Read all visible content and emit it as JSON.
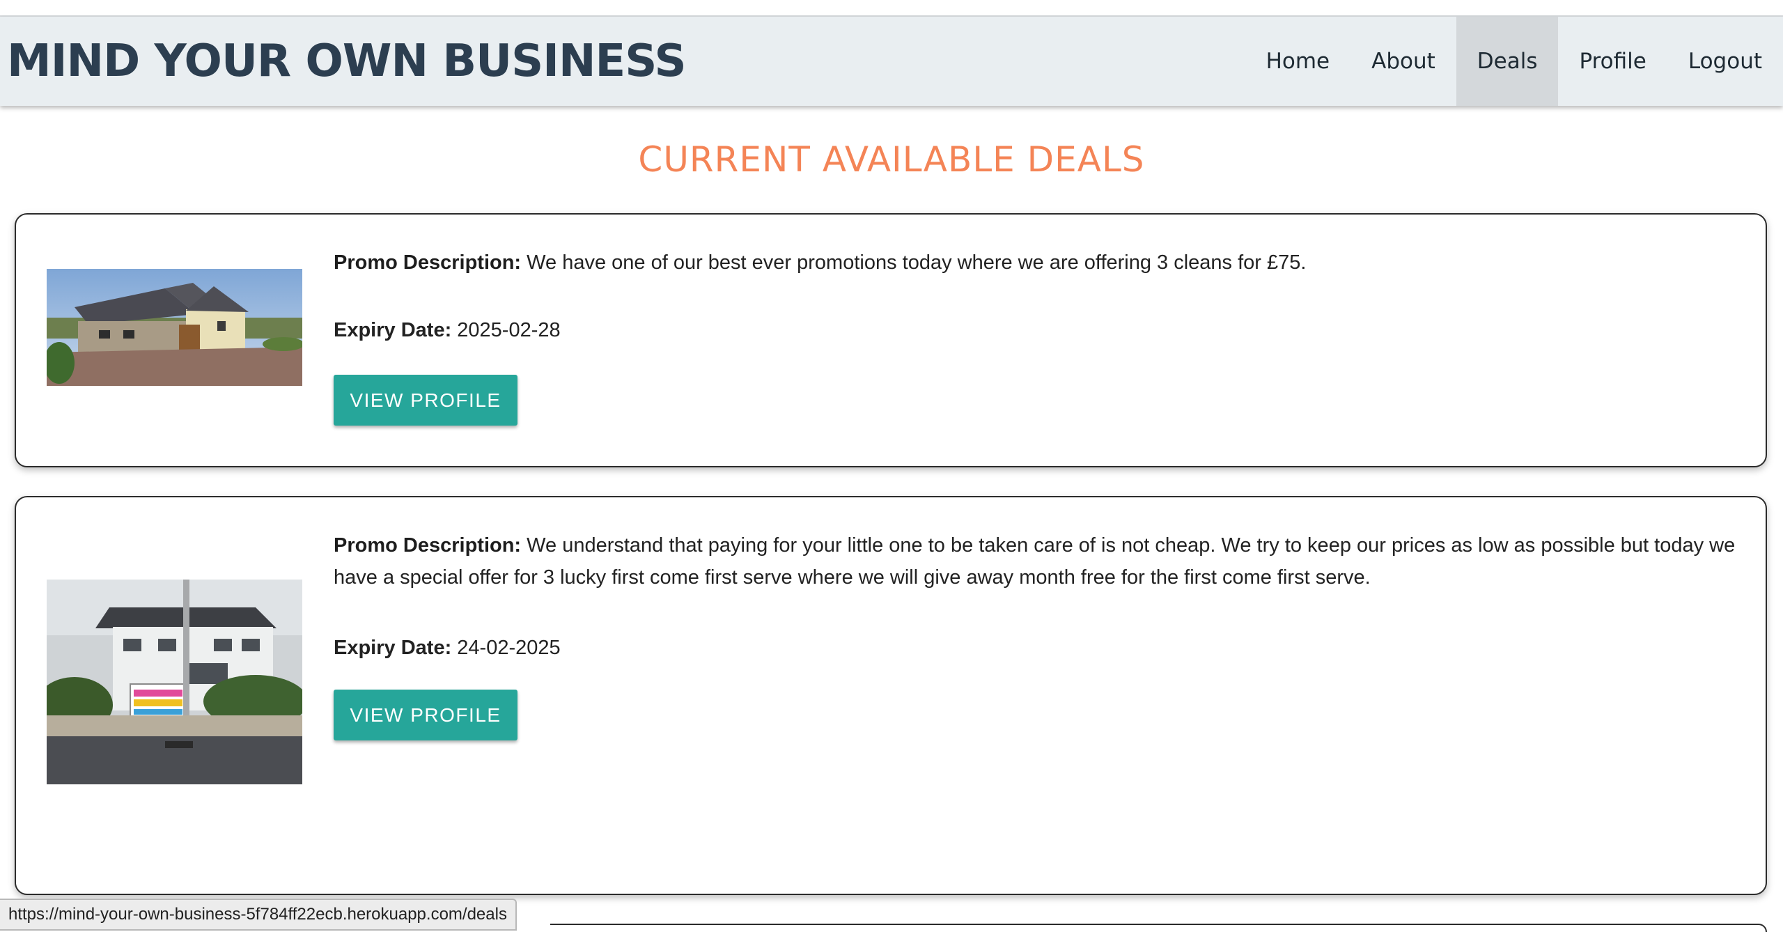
{
  "navbar": {
    "brand": "MIND YOUR OWN BUSINESS",
    "links": [
      {
        "label": "Home",
        "active": false
      },
      {
        "label": "About",
        "active": false
      },
      {
        "label": "Deals",
        "active": true
      },
      {
        "label": "Profile",
        "active": false
      },
      {
        "label": "Logout",
        "active": false
      }
    ]
  },
  "main": {
    "heading": "CURRENT AVAILABLE DEALS",
    "deals": [
      {
        "promo_label": "Promo Description:",
        "promo_text": "We have one of our best ever promotions today where we are offering 3 cleans for £75.",
        "expiry_label": "Expiry Date:",
        "expiry_value": "2025-02-28",
        "button_label": "VIEW PROFILE"
      },
      {
        "promo_label": "Promo Description:",
        "promo_text": "We understand that paying for your little one to be taken care of is not cheap. We try to keep our prices as low as possible but today we have a special offer for 3 lucky first come first serve where we will give away month free for the first come first serve.",
        "expiry_label": "Expiry Date:",
        "expiry_value": "24-02-2025",
        "button_label": "VIEW PROFILE"
      }
    ]
  },
  "status_bar": {
    "url": "https://mind-your-own-business-5f784ff22ecb.herokuapp.com/deals"
  },
  "colors": {
    "brand": "#2c3e50",
    "heading_accent": "#f48456",
    "button": "#26a69a",
    "navbar_bg": "#e9eef1",
    "nav_active_bg": "#d4d8db"
  }
}
